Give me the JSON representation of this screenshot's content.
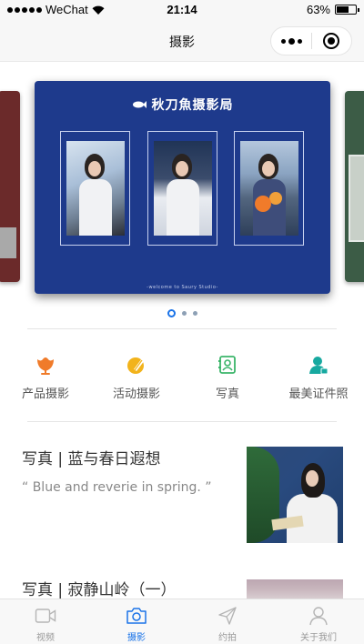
{
  "status_bar": {
    "carrier": "WeChat",
    "time": "21:14",
    "battery": "63%",
    "battery_level": 0.63
  },
  "nav": {
    "title": "摄影"
  },
  "carousel": {
    "active_index": 0,
    "slide_count": 3,
    "main_slide": {
      "brand": "秋刀魚摄影局",
      "footer": "-welcome to Saury Studio-",
      "background": "#1e3a8c"
    }
  },
  "categories": [
    {
      "label": "产品摄影",
      "icon": "flower-icon",
      "color": "#f07b2a"
    },
    {
      "label": "活动摄影",
      "icon": "pen-icon",
      "color": "#f2b31b"
    },
    {
      "label": "写真",
      "icon": "portrait-frame-icon",
      "color": "#3bb56a"
    },
    {
      "label": "最美证件照",
      "icon": "id-photo-icon",
      "color": "#17a9a0"
    }
  ],
  "articles": [
    {
      "title": "写真 | 蓝与春日遐想",
      "subtitle": "“ Blue and reverie in spring. ”"
    },
    {
      "title": "写真 | 寂静山岭（一）",
      "subtitle": ""
    }
  ],
  "tab_bar": {
    "active": "摄影",
    "accent": "#1a73e8",
    "tabs": [
      {
        "label": "视频",
        "icon": "video-icon"
      },
      {
        "label": "摄影",
        "icon": "camera-icon"
      },
      {
        "label": "约拍",
        "icon": "send-icon"
      },
      {
        "label": "关于我们",
        "icon": "user-icon"
      }
    ]
  }
}
